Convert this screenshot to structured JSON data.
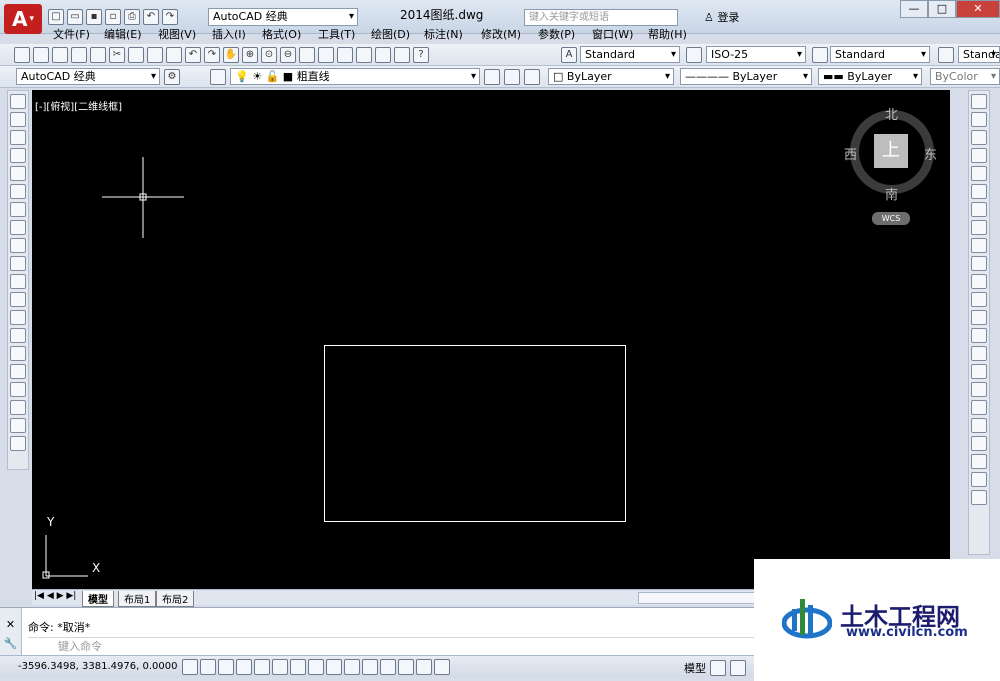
{
  "window": {
    "workspace": "AutoCAD 经典",
    "title": "2014图纸.dwg",
    "search_placeholder": "键入关键字或短语",
    "login_label": "登录"
  },
  "menu": {
    "items": [
      "文件(F)",
      "编辑(E)",
      "视图(V)",
      "插入(I)",
      "格式(O)",
      "工具(T)",
      "绘图(D)",
      "标注(N)",
      "修改(M)",
      "参数(P)",
      "窗口(W)",
      "帮助(H)"
    ]
  },
  "toolbar1": {
    "text_style": "Standard",
    "dim_style": "ISO-25",
    "table_style": "Standard",
    "mleader_style": "Standard"
  },
  "toolbar2": {
    "workspace": "AutoCAD 经典",
    "layer": "粗直线",
    "color": "ByLayer",
    "linetype": "ByLayer",
    "lineweight": "ByLayer",
    "plotstyle": "ByColor"
  },
  "canvas": {
    "viewport_label": "[-][俯视][二维线框]",
    "background": "#000000",
    "ucs_x": "X",
    "ucs_y": "Y"
  },
  "viewcube": {
    "north": "北",
    "south": "南",
    "east": "东",
    "west": "西",
    "top": "上",
    "wcs": "WCS"
  },
  "tabs": [
    "模型",
    "布局1",
    "布局2"
  ],
  "command": {
    "history": "命令: *取消*",
    "input_placeholder": "键入命令"
  },
  "status": {
    "coords": "-3596.3498, 3381.4976, 0.0000",
    "model": "模型"
  },
  "watermark": {
    "name": "土木工程网",
    "url": "www.civilcn.com"
  }
}
